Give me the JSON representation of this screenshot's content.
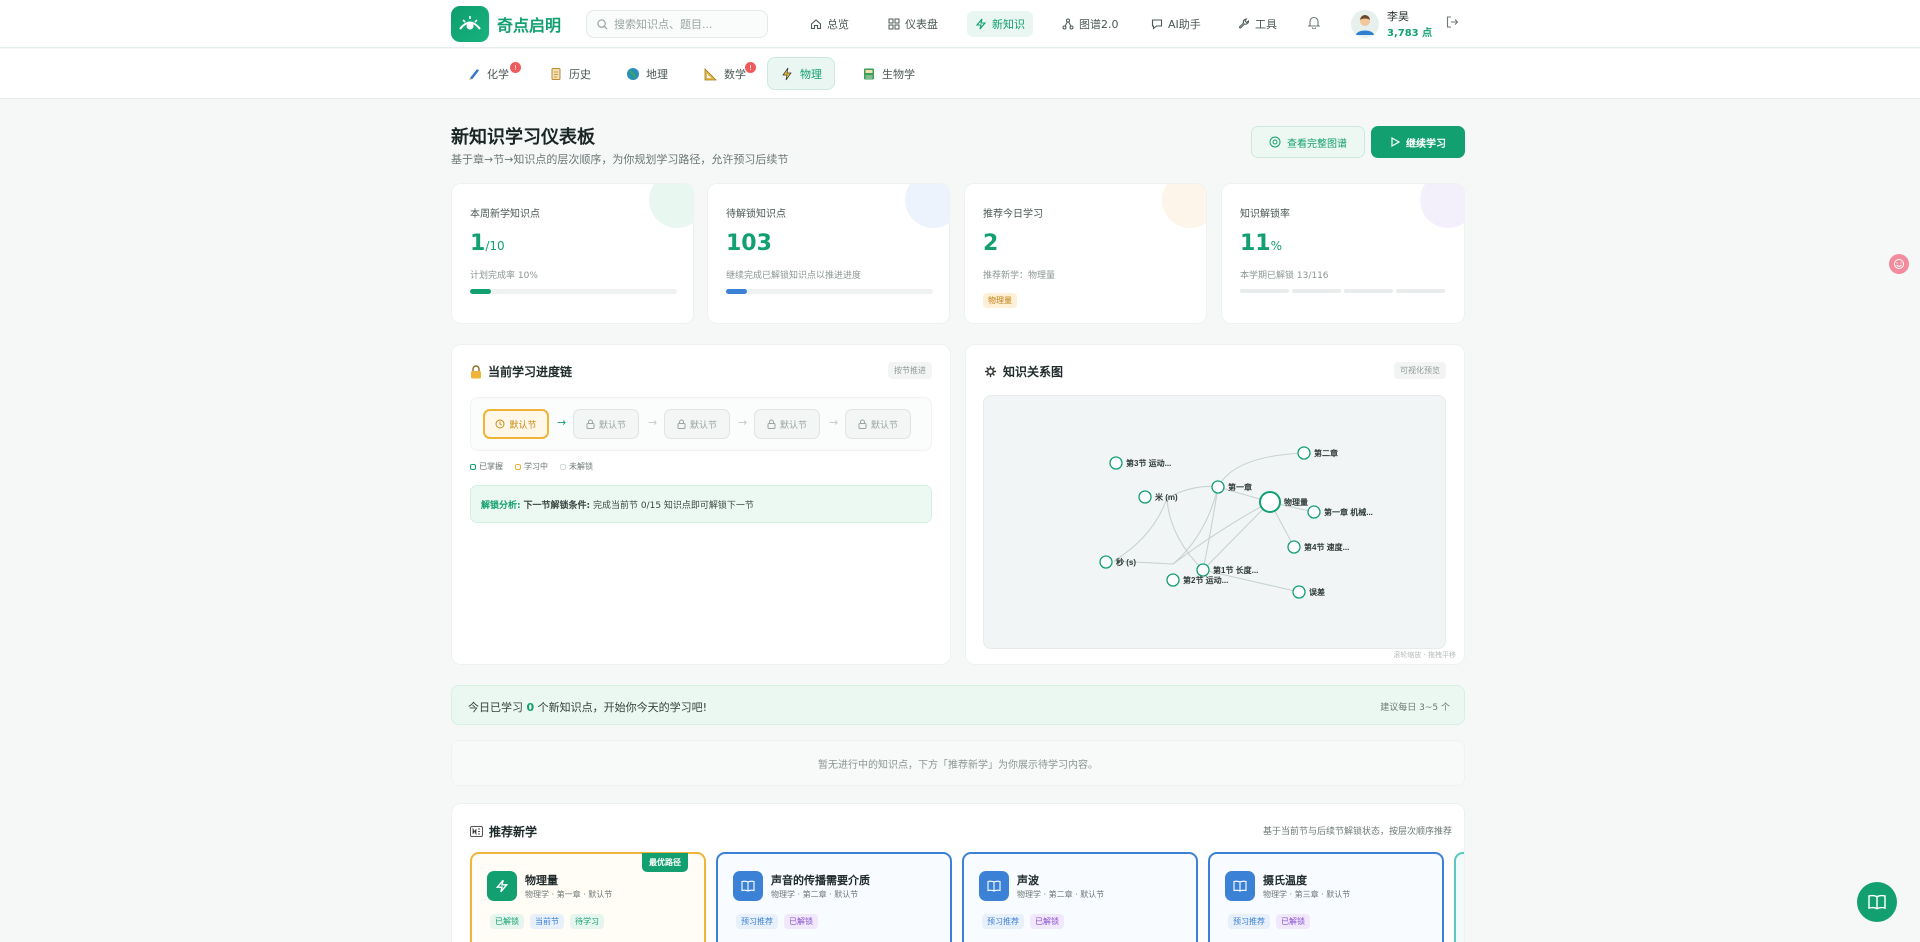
{
  "app": {
    "name": "奇点启明"
  },
  "search": {
    "placeholder": "搜索知识点、题目..."
  },
  "nav": [
    {
      "label": "总览",
      "icon": "home-icon"
    },
    {
      "label": "仪表盘",
      "icon": "grid-icon"
    },
    {
      "label": "新知识",
      "icon": "bolt-icon"
    },
    {
      "label": "图谱2.0",
      "icon": "graph-icon"
    },
    {
      "label": "AI助手",
      "icon": "chat-icon"
    },
    {
      "label": "工具",
      "icon": "wrench-icon"
    }
  ],
  "user": {
    "name": "李昊",
    "points": "3,783 点"
  },
  "subjects": [
    {
      "label": "化学",
      "icon": "flask-icon",
      "badge": "!"
    },
    {
      "label": "历史",
      "icon": "scroll-icon",
      "badge": ""
    },
    {
      "label": "地理",
      "icon": "globe-icon",
      "badge": ""
    },
    {
      "label": "数学",
      "icon": "ruler-icon",
      "badge": "!"
    },
    {
      "label": "物理",
      "icon": "bolt-icon",
      "badge": ""
    },
    {
      "label": "生物学",
      "icon": "book-icon",
      "badge": ""
    }
  ],
  "header": {
    "title": "新知识学习仪表板",
    "subtitle": "基于章→节→知识点的层次顺序，为你规划学习路径，允许预习后续节",
    "view_graph": "查看完整图谱",
    "continue": "继续学习"
  },
  "stats": [
    {
      "label": "本周新学知识点",
      "value": "1",
      "unit": "/10",
      "note": "计划完成率 10%",
      "progress": 0.1,
      "color": "#12a070",
      "deco": "#bfe8d6"
    },
    {
      "label": "待解锁知识点",
      "value": "103",
      "unit": "",
      "note": "继续完成已解锁知识点以推进进度",
      "progress": 0.1,
      "color": "#3b82d6",
      "deco": "#c9dcf5"
    },
    {
      "label": "推荐今日学习",
      "value": "2",
      "unit": "",
      "note": "推荐新学：物理量",
      "tag": "物理量",
      "color": "#12a070",
      "deco": "#f8e3bf"
    },
    {
      "label": "知识解锁率",
      "value": "11",
      "unit": "%",
      "note": "本学期已解锁 13/116",
      "progress": 0.11,
      "color": "#12a070",
      "deco": "#e0d4f3"
    }
  ],
  "chain": {
    "title": "当前学习进度链",
    "pill": "按节推进",
    "nodes": [
      "默认节",
      "默认节",
      "默认节",
      "默认节",
      "默认节"
    ],
    "legend": [
      "已掌握",
      "学习中",
      "未解锁"
    ],
    "unlock_label": "解锁分析:",
    "unlock_cond": "下一节解锁条件:",
    "unlock_text": "完成当前节 0/15 知识点即可解锁下一节"
  },
  "graph": {
    "title": "知识关系图",
    "pill": "可视化预览",
    "footer": "滚轮缩放 · 拖拽平移",
    "nodes": [
      "第二章",
      "第3节 运动...",
      "第一章",
      "米 (m)",
      "物理量",
      "第一章 机械...",
      "第4节 速度...",
      "秒 (s)",
      "第1节 长度...",
      "第2节 运动...",
      "误差"
    ]
  },
  "today": {
    "prefix": "今日已学习 ",
    "count": "0",
    "suffix": " 个新知识点，开始你今天的学习吧!",
    "hint": "建议每日 3~5 个"
  },
  "empty_text": "暂无进行中的知识点，下方「推荐新学」为你展示待学习内容。",
  "recommend": {
    "title": "推荐新学",
    "right": "基于当前节与后续节解锁状态，按层次顺序推荐",
    "best_label": "最优路径",
    "cards": [
      {
        "name": "物理量",
        "meta": "物理学 · 第一章 · 默认节",
        "tags": [
          "已解锁",
          "当前节",
          "待学习"
        ],
        "icon_color": "#12a070"
      },
      {
        "name": "声音的传播需要介质",
        "meta": "物理学 · 第二章 · 默认节",
        "tags": [
          "预习推荐",
          "已解锁"
        ],
        "icon_color": "#3b82d6"
      },
      {
        "name": "声波",
        "meta": "物理学 · 第二章 · 默认节",
        "tags": [
          "预习推荐",
          "已解锁"
        ],
        "icon_color": "#3b82d6"
      },
      {
        "name": "摄氏温度",
        "meta": "物理学 · 第三章 · 默认节",
        "tags": [
          "预习推荐",
          "已解锁"
        ],
        "icon_color": "#3b82d6"
      }
    ]
  },
  "colors": {
    "accent": "#12a070",
    "blue": "#3b82d6",
    "amber": "#f0b43a"
  }
}
